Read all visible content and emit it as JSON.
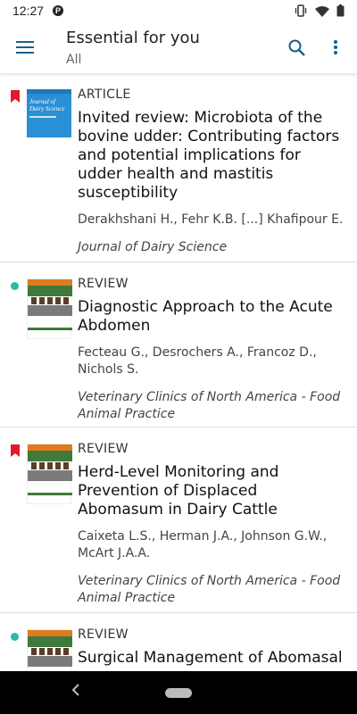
{
  "status": {
    "time": "12:27",
    "app_badge": "P"
  },
  "header": {
    "title": "Essential for you",
    "subtitle": "All"
  },
  "colors": {
    "accent": "#1a5f8e",
    "bookmark": "#e0192b",
    "new_dot": "#2cb9a0"
  },
  "articles": [
    {
      "type": "ARTICLE",
      "indicator": "bookmark-icon",
      "title": "Invited review: Microbiota of the bovine udder: Contributing factors and potential implications for udder health and mastitis susceptibility",
      "authors": "Derakhshani  H., Fehr  K.B. [...] Khafipour  E.",
      "journal": "Journal of Dairy Science",
      "cover": "journal-of-dairy-science-cover",
      "cover_title": "Journal of Dairy Science"
    },
    {
      "type": "REVIEW",
      "indicator": "new-dot",
      "title": "Diagnostic Approach to the Acute Abdomen",
      "authors": "Fecteau  G., Desrochers  A., Francoz  D., Nichols  S.",
      "journal": "Veterinary Clinics of North America - Food Animal Practice",
      "cover": "vet-clinics-cover"
    },
    {
      "type": "REVIEW",
      "indicator": "bookmark-icon",
      "title": "Herd-Level Monitoring and Prevention of Displaced Abomasum in Dairy Cattle",
      "authors": "Caixeta  L.S., Herman  J.A., Johnson  G.W., McArt  J.A.A.",
      "journal": "Veterinary Clinics of North America - Food Animal Practice",
      "cover": "vet-clinics-cover"
    },
    {
      "type": "REVIEW",
      "indicator": "new-dot",
      "title": "Surgical Management of Abomasal",
      "cover": "vet-clinics-cover"
    }
  ]
}
